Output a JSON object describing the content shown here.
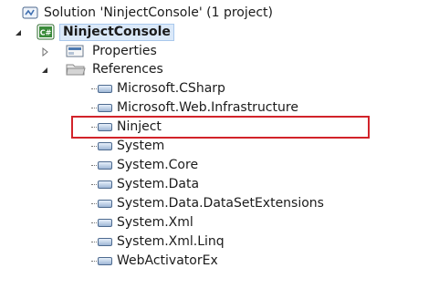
{
  "solution": {
    "label": "Solution 'NinjectConsole' (1 project)"
  },
  "project": {
    "label": "NinjectConsole"
  },
  "properties": {
    "label": "Properties"
  },
  "references": {
    "label": "References",
    "items": [
      "Microsoft.CSharp",
      "Microsoft.Web.Infrastructure",
      "Ninject",
      "System",
      "System.Core",
      "System.Data",
      "System.Data.DataSetExtensions",
      "System.Xml",
      "System.Xml.Linq",
      "WebActivatorEx"
    ]
  },
  "colors": {
    "highlight_border": "#d2232a",
    "selection_bg": "#dbe9f9",
    "csharp_badge": "#3a8b3a"
  }
}
